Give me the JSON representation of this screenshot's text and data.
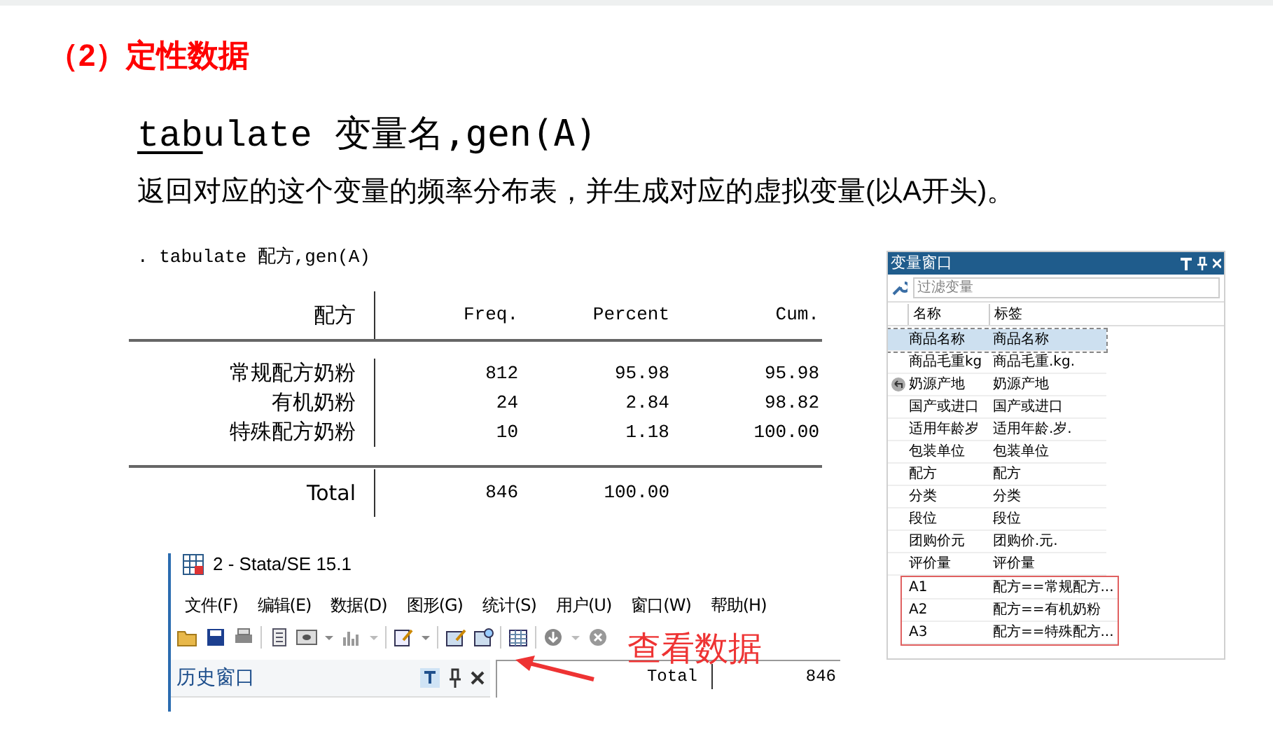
{
  "heading": "（2）定性数据",
  "syntax": {
    "abbrev": "tab",
    "rest": "ulate",
    "args": "变量名,gen(A)"
  },
  "description": "返回对应的这个变量的频率分布表，并生成对应的虚拟变量(以A开头)。",
  "stata_output": {
    "command": ". tabulate 配方,gen(A)",
    "columns": [
      "配方",
      "Freq.",
      "Percent",
      "Cum."
    ],
    "rows": [
      {
        "cells": [
          "常规配方奶粉",
          "812",
          "95.98",
          "95.98"
        ]
      },
      {
        "cells": [
          "有机奶粉",
          "24",
          "2.84",
          "98.82"
        ]
      },
      {
        "cells": [
          "特殊配方奶粉",
          "10",
          "1.18",
          "100.00"
        ]
      }
    ],
    "total": [
      "Total",
      "846",
      "100.00"
    ]
  },
  "stata_window": {
    "title": "2 - Stata/SE 15.1",
    "menu": [
      "文件(F)",
      "编辑(E)",
      "数据(D)",
      "图形(G)",
      "统计(S)",
      "用户(U)",
      "窗口(W)",
      "帮助(H)"
    ],
    "annotation": "查看数据",
    "history_title": "历史窗口",
    "results": [
      "Total",
      "846"
    ]
  },
  "variables_window": {
    "title": "变量窗口",
    "filter_placeholder": "过滤变量",
    "columns": [
      "名称",
      "标签"
    ],
    "rows": [
      {
        "name": "商品名称",
        "label": "商品名称",
        "selected": true,
        "flagged": false,
        "outlined": false
      },
      {
        "name": "商品毛重kg",
        "label": "商品毛重.kg.",
        "selected": false,
        "flagged": false,
        "outlined": false
      },
      {
        "name": "奶源产地",
        "label": "奶源产地",
        "selected": false,
        "flagged": true,
        "outlined": false
      },
      {
        "name": "国产或进口",
        "label": "国产或进口",
        "selected": false,
        "flagged": false,
        "outlined": false
      },
      {
        "name": "适用年龄岁",
        "label": "适用年龄.岁.",
        "selected": false,
        "flagged": false,
        "outlined": false
      },
      {
        "name": "包装单位",
        "label": "包装单位",
        "selected": false,
        "flagged": false,
        "outlined": false
      },
      {
        "name": "配方",
        "label": "配方",
        "selected": false,
        "flagged": false,
        "outlined": false
      },
      {
        "name": "分类",
        "label": "分类",
        "selected": false,
        "flagged": false,
        "outlined": false
      },
      {
        "name": "段位",
        "label": "段位",
        "selected": false,
        "flagged": false,
        "outlined": false
      },
      {
        "name": "团购价元",
        "label": "团购价.元.",
        "selected": false,
        "flagged": false,
        "outlined": false
      },
      {
        "name": "评价量",
        "label": "评价量",
        "selected": false,
        "flagged": false,
        "outlined": false
      },
      {
        "name": "A1",
        "label": "配方==常规配方...",
        "selected": false,
        "flagged": false,
        "outlined": true
      },
      {
        "name": "A2",
        "label": "配方==有机奶粉",
        "selected": false,
        "flagged": false,
        "outlined": true
      },
      {
        "name": "A3",
        "label": "配方==特殊配方...",
        "selected": false,
        "flagged": false,
        "outlined": true
      }
    ]
  }
}
